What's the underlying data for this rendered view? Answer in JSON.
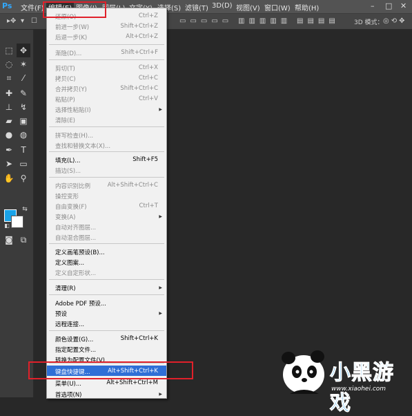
{
  "app": {
    "logo": "Ps"
  },
  "menubar": {
    "items": [
      "文件(F)",
      "编辑(E)",
      "图像(I)",
      "图层(L)",
      "文字(Y)",
      "选择(S)",
      "滤镜(T)",
      "3D(D)",
      "视图(V)",
      "窗口(W)",
      "帮助(H)"
    ],
    "window_controls": [
      "–",
      "□",
      "✕"
    ]
  },
  "options_bar": {
    "mode_label": "3D 模式："
  },
  "colors": {
    "foreground": "#1aa3e8",
    "background": "#ffffff",
    "highlight": "#2f6fd6",
    "annotation": "#e0202a"
  },
  "edit_menu": {
    "items": [
      {
        "label": "还原(O)",
        "shortcut": "Ctrl+Z",
        "disabled": true
      },
      {
        "label": "前进一步(W)",
        "shortcut": "Shift+Ctrl+Z",
        "disabled": true
      },
      {
        "label": "后退一步(K)",
        "shortcut": "Alt+Ctrl+Z",
        "disabled": true
      },
      {
        "label": "渐隐(D)...",
        "shortcut": "Shift+Ctrl+F",
        "disabled": true
      },
      {
        "label": "剪切(T)",
        "shortcut": "Ctrl+X",
        "disabled": true
      },
      {
        "label": "拷贝(C)",
        "shortcut": "Ctrl+C",
        "disabled": true
      },
      {
        "label": "合并拷贝(Y)",
        "shortcut": "Shift+Ctrl+C",
        "disabled": true
      },
      {
        "label": "粘贴(P)",
        "shortcut": "Ctrl+V",
        "disabled": true
      },
      {
        "label": "选择性粘贴(I)",
        "shortcut": "",
        "disabled": true
      },
      {
        "label": "清除(E)",
        "shortcut": "",
        "disabled": true
      },
      {
        "label": "拼写检查(H)...",
        "shortcut": "",
        "disabled": true
      },
      {
        "label": "查找和替换文本(X)...",
        "shortcut": "",
        "disabled": true
      },
      {
        "label": "填充(L)...",
        "shortcut": "Shift+F5",
        "disabled": false
      },
      {
        "label": "描边(S)...",
        "shortcut": "",
        "disabled": true
      },
      {
        "label": "内容识别比例",
        "shortcut": "Alt+Shift+Ctrl+C",
        "disabled": true
      },
      {
        "label": "操控变形",
        "shortcut": "",
        "disabled": true
      },
      {
        "label": "自由变换(F)",
        "shortcut": "Ctrl+T",
        "disabled": true
      },
      {
        "label": "变换(A)",
        "shortcut": "",
        "disabled": true
      },
      {
        "label": "自动对齐图层...",
        "shortcut": "",
        "disabled": true
      },
      {
        "label": "自动混合图层...",
        "shortcut": "",
        "disabled": true
      },
      {
        "label": "定义画笔预设(B)...",
        "shortcut": "",
        "disabled": false
      },
      {
        "label": "定义图案...",
        "shortcut": "",
        "disabled": false
      },
      {
        "label": "定义自定形状...",
        "shortcut": "",
        "disabled": true
      },
      {
        "label": "清理(R)",
        "shortcut": "",
        "disabled": false
      },
      {
        "label": "Adobe PDF 预设...",
        "shortcut": "",
        "disabled": false
      },
      {
        "label": "预设",
        "shortcut": "",
        "disabled": false
      },
      {
        "label": "远程连接...",
        "shortcut": "",
        "disabled": false
      },
      {
        "label": "颜色设置(G)...",
        "shortcut": "Shift+Ctrl+K",
        "disabled": false
      },
      {
        "label": "指定配置文件...",
        "shortcut": "",
        "disabled": false
      },
      {
        "label": "转换为配置文件(V)...",
        "shortcut": "",
        "disabled": false
      },
      {
        "label": "键盘快捷键...",
        "shortcut": "Alt+Shift+Ctrl+K",
        "disabled": false,
        "highlighted": true
      },
      {
        "label": "菜单(U)...",
        "shortcut": "Alt+Shift+Ctrl+M",
        "disabled": false
      },
      {
        "label": "首选项(N)",
        "shortcut": "",
        "disabled": false
      }
    ]
  },
  "watermark": {
    "brand": "小黑游戏",
    "url": "www.xiaohei.com"
  }
}
